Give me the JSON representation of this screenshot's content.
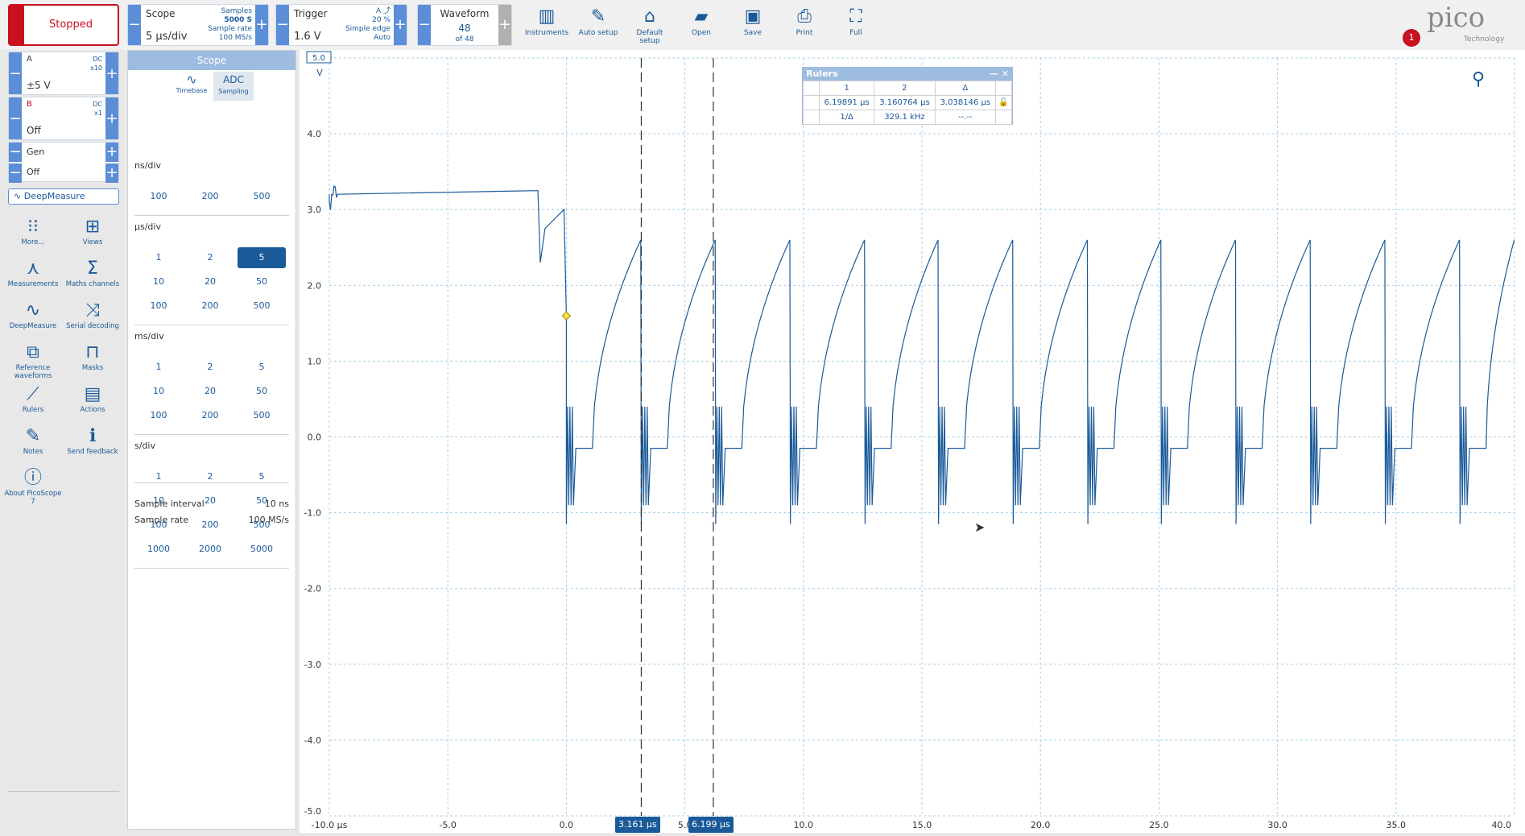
{
  "status": {
    "label": "Stopped"
  },
  "scope": {
    "title": "Scope",
    "samples_label": "Samples",
    "samples": "5000 S",
    "rate_label": "Sample rate",
    "rate": "100 MS/s",
    "timebase": "5 µs/div"
  },
  "trigger": {
    "title": "Trigger",
    "channel": "A",
    "percent": "20 %",
    "type": "Simple edge",
    "mode": "Auto",
    "level": "1.6 V"
  },
  "waveform": {
    "title": "Waveform",
    "num": "48",
    "of": "of 48"
  },
  "toolbar": [
    "Instruments",
    "Auto setup",
    "Default setup",
    "Open",
    "Save",
    "Print",
    "Full"
  ],
  "brand": {
    "logo": "pico",
    "sub": "Technology",
    "badge": "1"
  },
  "channels": {
    "a": {
      "name": "A",
      "coupling": "DC",
      "probe": "x10",
      "range": "±5 V"
    },
    "b": {
      "name": "B",
      "coupling": "DC",
      "probe": "x1",
      "range": "Off"
    },
    "gen": {
      "name": "Gen",
      "state": "Off"
    }
  },
  "deepmeasure": "DeepMeasure",
  "side": [
    "More...",
    "Views",
    "Measurements",
    "Maths channels",
    "DeepMeasure",
    "Serial decoding",
    "Reference waveforms",
    "Masks",
    "Rulers",
    "Actions",
    "Notes",
    "Send feedback",
    "About PicoScope 7"
  ],
  "panel": {
    "title": "Scope",
    "tabs": [
      "Timebase",
      "Sampling"
    ],
    "groups": [
      {
        "title": "ns/div",
        "rows": [
          [
            "100",
            "200",
            "500"
          ]
        ]
      },
      {
        "title": "µs/div",
        "rows": [
          [
            "1",
            "2",
            "5"
          ],
          [
            "10",
            "20",
            "50"
          ],
          [
            "100",
            "200",
            "500"
          ]
        ]
      },
      {
        "title": "ms/div",
        "rows": [
          [
            "1",
            "2",
            "5"
          ],
          [
            "10",
            "20",
            "50"
          ],
          [
            "100",
            "200",
            "500"
          ]
        ]
      },
      {
        "title": "s/div",
        "rows": [
          [
            "1",
            "2",
            "5"
          ],
          [
            "10",
            "20",
            "50"
          ],
          [
            "100",
            "200",
            "500"
          ],
          [
            "1000",
            "2000",
            "5000"
          ]
        ]
      }
    ],
    "interval_label": "Sample interval",
    "interval": "10 ns",
    "rate_label": "Sample rate",
    "rate": "100 MS/s"
  },
  "rulers": {
    "title": "Rulers",
    "cols": [
      "1",
      "2",
      "Δ"
    ],
    "row1": [
      "6.19891 µs",
      "3.160764 µs",
      "3.038146 µs"
    ],
    "row2": [
      "1/Δ",
      "329.1 kHz",
      "--.--"
    ]
  },
  "ruler_labels": [
    "3.161 µs",
    "6.199 µs"
  ],
  "chart_data": {
    "type": "line",
    "y_ticks": [
      "5.0",
      "4.0",
      "3.0",
      "2.0",
      "1.0",
      "0.0",
      "-1.0",
      "-2.0",
      "-3.0",
      "-4.0",
      "-5.0"
    ],
    "y_unit": "V",
    "x_ticks": [
      "-10.0 µs",
      "-5.0",
      "0.0",
      "5.0",
      "10.0",
      "15.0",
      "20.0",
      "25.0",
      "30.0",
      "35.0",
      "40.0"
    ],
    "xlim": [
      -10,
      40
    ],
    "ylim": [
      -5,
      5
    ],
    "rulers_x": [
      3.161,
      6.199
    ],
    "trigger": {
      "x": 0,
      "y": 1.6
    },
    "pulses_x": [
      0,
      3.16,
      6.3,
      9.45,
      12.6,
      15.7,
      18.85,
      22,
      25.1,
      28.25,
      31.4,
      34.55,
      37.7
    ]
  }
}
